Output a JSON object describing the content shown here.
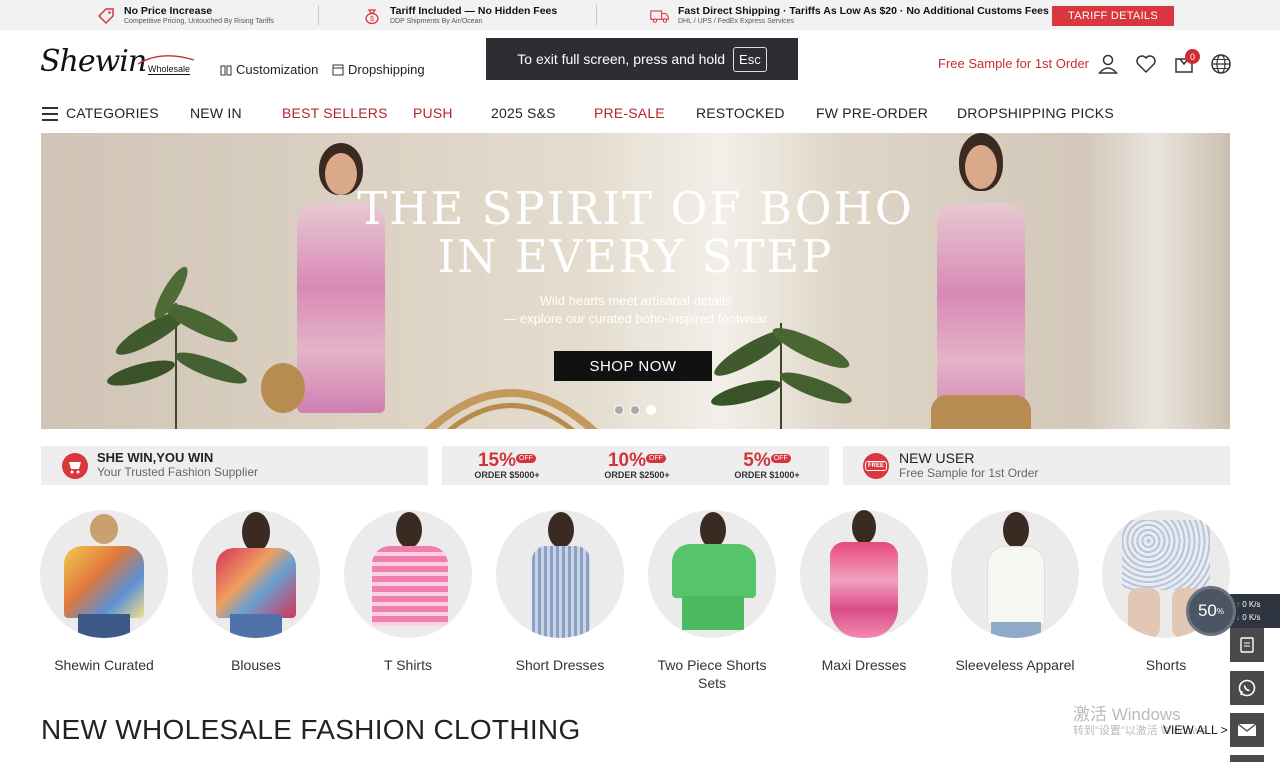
{
  "topbar": {
    "items": [
      {
        "title": "No Price Increase",
        "subtitle": "Competitive Pricing, Untouched By Rising Tariffs"
      },
      {
        "title": "Tariff Included — No Hidden Fees",
        "subtitle": "DDP Shipments By Air/Ocean"
      },
      {
        "title": "Fast Direct Shipping · Tariffs As Low As $20 · No Additional Customs Fees",
        "subtitle": "DHL / UPS / FedEx Express Services"
      }
    ],
    "tariff_button": "TARIFF DETAILS"
  },
  "header": {
    "logo_text": "Shewin",
    "logo_sub": "Wholesale",
    "links": [
      "Customization",
      "Dropshipping"
    ],
    "esc_text": "To exit full screen, press and hold",
    "esc_key": "Esc",
    "free_sample": "Free Sample for 1st Order",
    "cart_count": "0"
  },
  "nav": {
    "items": [
      {
        "label": "CATEGORIES"
      },
      {
        "label": "NEW IN"
      },
      {
        "label": "BEST SELLERS"
      },
      {
        "label": "PUSH"
      },
      {
        "label": "2025 S&S"
      },
      {
        "label": "PRE-SALE"
      },
      {
        "label": "RESTOCKED"
      },
      {
        "label": "FW PRE-ORDER"
      },
      {
        "label": "DROPSHIPPING PICKS"
      }
    ]
  },
  "banner": {
    "title_line1": "THE SPIRIT OF BOHO",
    "title_line2": "IN EVERY STEP",
    "sub_line1": "Wild hearts meet artisanal details",
    "sub_line2": "— explore our curated boho-inspired footwear",
    "button": "SHOP NOW"
  },
  "promos": {
    "left_title": "SHE WIN,YOU WIN",
    "left_sub": "Your Trusted Fashion Supplier",
    "discounts": [
      {
        "pct": "15%",
        "off": "OFF",
        "order": "ORDER $5000+"
      },
      {
        "pct": "10%",
        "off": "OFF",
        "order": "ORDER $2500+"
      },
      {
        "pct": "5%",
        "off": "OFF",
        "order": "ORDER $1000+"
      }
    ],
    "right_icon": "FREE",
    "right_title": "NEW USER",
    "right_sub": "Free Sample for 1st Order"
  },
  "categories": [
    {
      "label": "Shewin Curated"
    },
    {
      "label": "Blouses"
    },
    {
      "label": "T Shirts"
    },
    {
      "label": "Short Dresses"
    },
    {
      "label": "Two Piece Shorts Sets"
    },
    {
      "label": "Maxi Dresses"
    },
    {
      "label": "Sleeveless Apparel"
    },
    {
      "label": "Shorts"
    }
  ],
  "section": {
    "title": "NEW WHOLESALE FASHION CLOTHING",
    "view_all": "VIEW ALL >"
  },
  "overlay": {
    "speed_pct": "50",
    "speed_unit": "%",
    "up": "0 K/s",
    "down": "0 K/s",
    "windows_line1": "激活 Windows",
    "windows_line2": "转到\"设置\"以激活 Windows"
  },
  "colors": {
    "accent_red": "#d9363e",
    "nav_red": "#b5252d",
    "dark": "#222222"
  }
}
